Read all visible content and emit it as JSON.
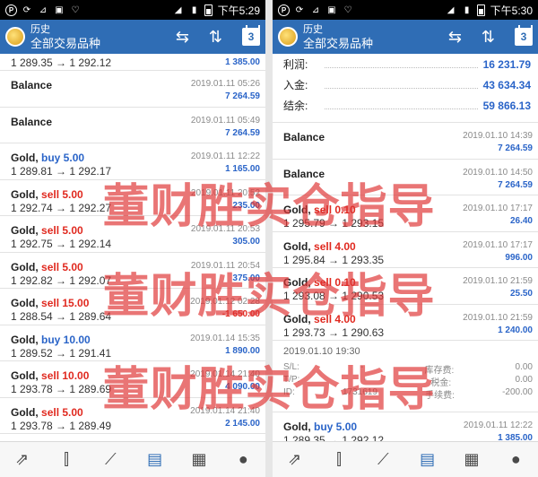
{
  "left": {
    "status": {
      "time": "下午5:29"
    },
    "appbar": {
      "subtitle": "历史",
      "title": "全部交易品种",
      "calendar": "3"
    },
    "partial": {
      "prices": "1 289.35 → 1 292.12",
      "amount": "1 385.00"
    },
    "rows": [
      {
        "title": "Balance",
        "time": "2019.01.11 05:26",
        "amount": "7 264.59",
        "sign": "pos"
      },
      {
        "title": "Balance",
        "time": "2019.01.11 05:49",
        "amount": "7 264.59",
        "sign": "pos"
      },
      {
        "symbol": "Gold,",
        "side": "buy 5.00",
        "side_type": "buy",
        "prices": "1 289.81 → 1 292.17",
        "time": "2019.01.11 12:22",
        "amount": "1 165.00",
        "sign": "pos"
      },
      {
        "symbol": "Gold,",
        "side": "sell 5.00",
        "side_type": "sell",
        "prices": "1 292.74 → 1 292.27",
        "time": "2019.01.11 20:52",
        "amount": "235.00",
        "sign": "pos"
      },
      {
        "symbol": "Gold,",
        "side": "sell 5.00",
        "side_type": "sell",
        "prices": "1 292.75 → 1 292.14",
        "time": "2019.01.11 20:53",
        "amount": "305.00",
        "sign": "pos"
      },
      {
        "symbol": "Gold,",
        "side": "sell 5.00",
        "side_type": "sell",
        "prices": "1 292.82 → 1 292.07",
        "time": "2019.01.11 20:54",
        "amount": "375.00",
        "sign": "pos"
      },
      {
        "symbol": "Gold,",
        "side": "sell 15.00",
        "side_type": "sell",
        "prices": "1 288.54 → 1 289.64",
        "time": "2019.01.12 02:28",
        "amount": "-1 650.00",
        "sign": "neg"
      },
      {
        "symbol": "Gold,",
        "side": "buy 10.00",
        "side_type": "buy",
        "prices": "1 289.52 → 1 291.41",
        "time": "2019.01.14 15:35",
        "amount": "1 890.00",
        "sign": "pos"
      },
      {
        "symbol": "Gold,",
        "side": "sell 10.00",
        "side_type": "sell",
        "prices": "1 293.78 → 1 289.69",
        "time": "2019.01.14 21:40",
        "amount": "4 090.00",
        "sign": "pos"
      },
      {
        "symbol": "Gold,",
        "side": "sell 5.00",
        "side_type": "sell",
        "prices": "1 293.78 → 1 289.49",
        "time": "2019.01.14 21:40",
        "amount": "2 145.00",
        "sign": "pos"
      }
    ]
  },
  "right": {
    "status": {
      "time": "下午5:30"
    },
    "appbar": {
      "subtitle": "历史",
      "title": "全部交易品种",
      "calendar": "3"
    },
    "summary": [
      {
        "label": "利润:",
        "value": "16 231.79"
      },
      {
        "label": "入金:",
        "value": "43 634.34"
      },
      {
        "label": "结余:",
        "value": "59 866.13"
      }
    ],
    "rows_a": [
      {
        "title": "Balance",
        "time": "2019.01.10 14:39",
        "amount": "7 264.59",
        "sign": "pos"
      },
      {
        "title": "Balance",
        "time": "2019.01.10 14:50",
        "amount": "7 264.59",
        "sign": "pos"
      },
      {
        "symbol": "Gold,",
        "side": "sell 0.10",
        "side_type": "sell",
        "prices": "1 295.79 → 1 293.15",
        "time": "2019.01.10 17:17",
        "amount": "26.40",
        "sign": "pos"
      },
      {
        "symbol": "Gold,",
        "side": "sell 4.00",
        "side_type": "sell",
        "prices": "1 295.84 → 1 293.35",
        "time": "2019.01.10 17:17",
        "amount": "996.00",
        "sign": "pos"
      },
      {
        "symbol": "Gold,",
        "side": "sell 0.10",
        "side_type": "sell",
        "prices": "1 293.08 → 1 290.53",
        "time": "2019.01.10 21:59",
        "amount": "25.50",
        "sign": "pos"
      },
      {
        "symbol": "Gold,",
        "side": "sell 4.00",
        "side_type": "sell",
        "prices": "1 293.73 → 1 290.63",
        "time": "2019.01.10 21:59",
        "amount": "1 240.00",
        "sign": "pos"
      }
    ],
    "expanded": {
      "date": "2019.01.10 19:30",
      "sl_label": "S/L:",
      "sl_value": "-",
      "swap_label": "库存费:",
      "swap_value": "0.00",
      "tp_label": "T/P:",
      "tp_value": "-",
      "tax_label": "税金:",
      "tax_value": "0.00",
      "id_label": "ID:",
      "id_value": "1731619",
      "fee_label": "手续费:",
      "fee_value": "-200.00"
    },
    "rows_b": [
      {
        "symbol": "Gold,",
        "side": "buy 5.00",
        "side_type": "buy",
        "prices": "1 289.35 → 1 292.12",
        "time": "2019.01.11 12:22",
        "amount": "1 385.00",
        "sign": "pos"
      }
    ]
  },
  "nav_icons": [
    "trend-icon",
    "candles-icon",
    "chart-line-icon",
    "inbox-icon",
    "news-icon",
    "chat-icon"
  ],
  "watermark": "董财胜实仓指导"
}
